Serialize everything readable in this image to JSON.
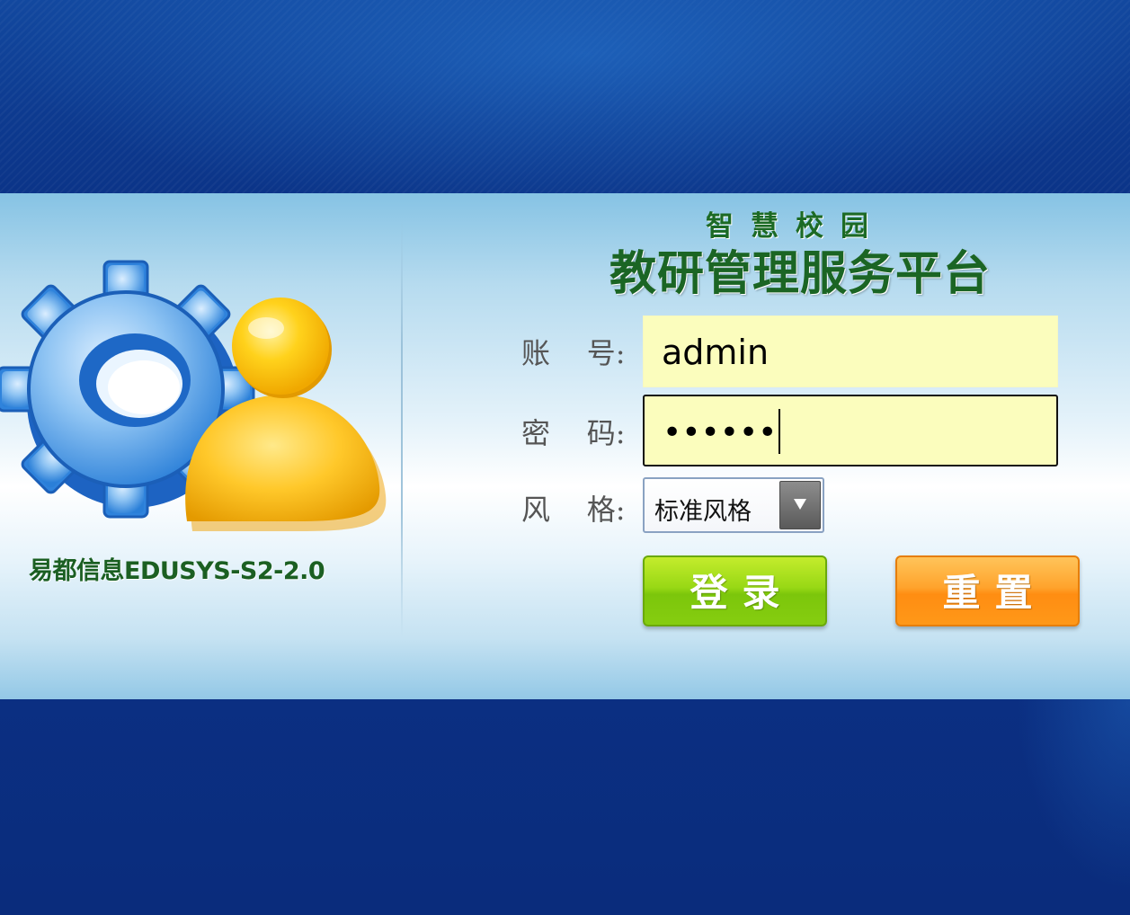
{
  "header": {
    "title_small": "智慧校园",
    "title_main": "教研管理服务平台"
  },
  "brand": {
    "text": "易都信息EDUSYS-S2-2.0",
    "icon": "gear-user-logo-icon"
  },
  "form": {
    "username": {
      "label": "账    号:",
      "value": "admin"
    },
    "password": {
      "label": "密    码:",
      "value": "••••••"
    },
    "style": {
      "label": "风    格:",
      "value": "标准风格",
      "icon": "chevron-down-icon"
    }
  },
  "buttons": {
    "login": "登录",
    "reset": "重置"
  },
  "colors": {
    "background": "#0b2e80",
    "title": "#1b6524",
    "input_bg": "#fbfdbd",
    "login_button": "#8ed312",
    "reset_button": "#ff9a20"
  }
}
